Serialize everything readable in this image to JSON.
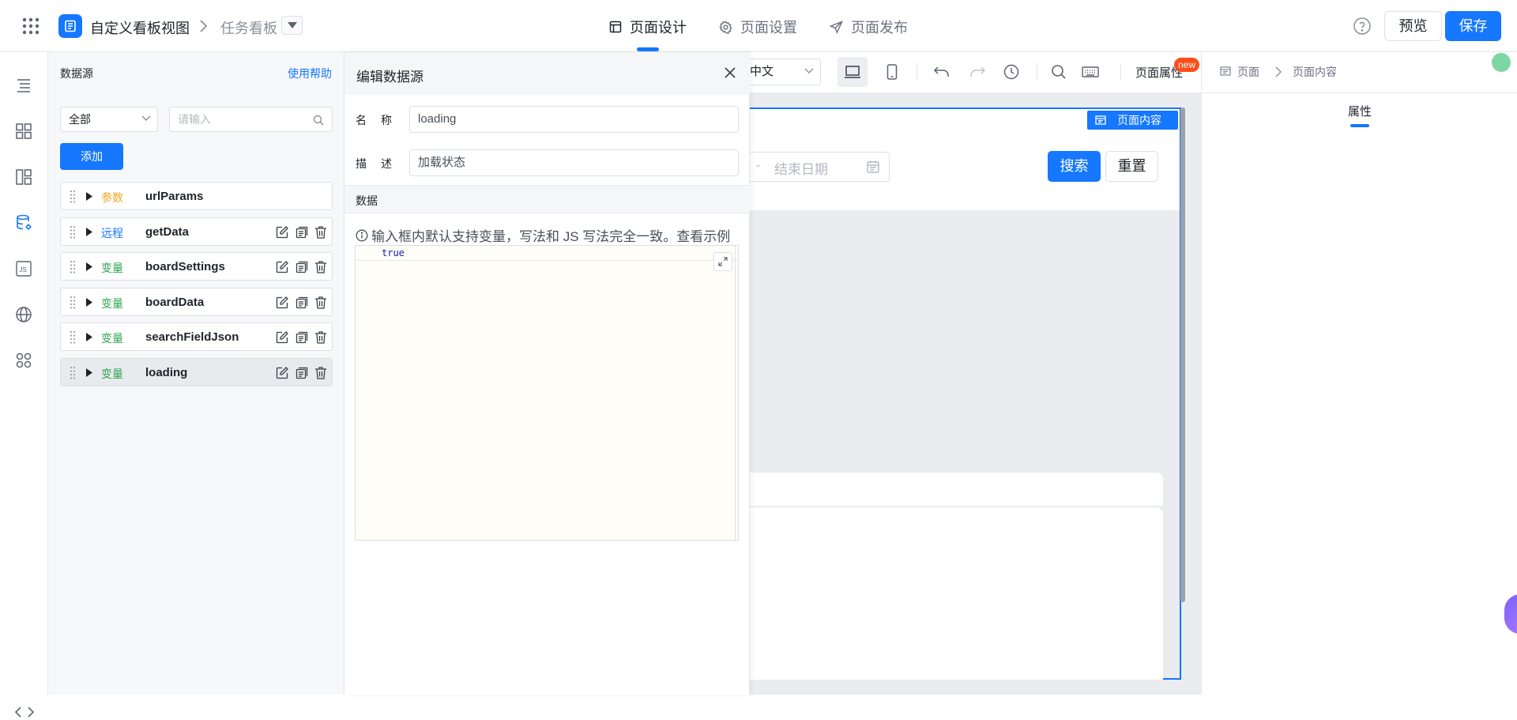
{
  "header": {
    "app_title": "自定义看板视图",
    "board_title": "任务看板",
    "tabs": [
      "页面设计",
      "页面设置",
      "页面发布"
    ],
    "active_tab": "页面设计",
    "preview_label": "预览",
    "save_label": "保存"
  },
  "datasource": {
    "title": "数据源",
    "help_label": "使用帮助",
    "filter_value": "全部",
    "search_placeholder": "请输入",
    "add_label": "添加",
    "items": [
      {
        "kind": "参数",
        "kind_color": "orange",
        "name": "urlParams",
        "actions": false
      },
      {
        "kind": "远程",
        "kind_color": "blue",
        "name": "getData",
        "actions": true
      },
      {
        "kind": "变量",
        "kind_color": "green",
        "name": "boardSettings",
        "actions": true
      },
      {
        "kind": "变量",
        "kind_color": "green",
        "name": "boardData",
        "actions": true
      },
      {
        "kind": "变量",
        "kind_color": "green",
        "name": "searchFieldJson",
        "actions": true
      },
      {
        "kind": "变量",
        "kind_color": "green",
        "name": "loading",
        "actions": true,
        "selected": true
      }
    ]
  },
  "drawer": {
    "title": "编辑数据源",
    "name_label": "名称",
    "name_value": "loading",
    "desc_label": "描述",
    "desc_value": "加载状态",
    "data_section": "数据",
    "tip": "输入框内默认支持变量，写法和 JS 写法完全一致。查看示例",
    "code": "true"
  },
  "canvas": {
    "lang_value": "中文",
    "page_attr_label": "页面属性",
    "new_badge": "new",
    "frame_tag": "页面内容",
    "date_separator": "-",
    "end_date_placeholder": "结束日期",
    "search_label": "搜索",
    "reset_label": "重置"
  },
  "right_panel": {
    "crumb_page": "页面",
    "crumb_content": "页面内容",
    "tab": "属性"
  },
  "colors": {
    "accent": "#1677ff",
    "kind_orange": "#f5a623",
    "kind_blue": "#1677ff",
    "kind_green": "#2ea44f",
    "badge": "#ff4d1a"
  }
}
